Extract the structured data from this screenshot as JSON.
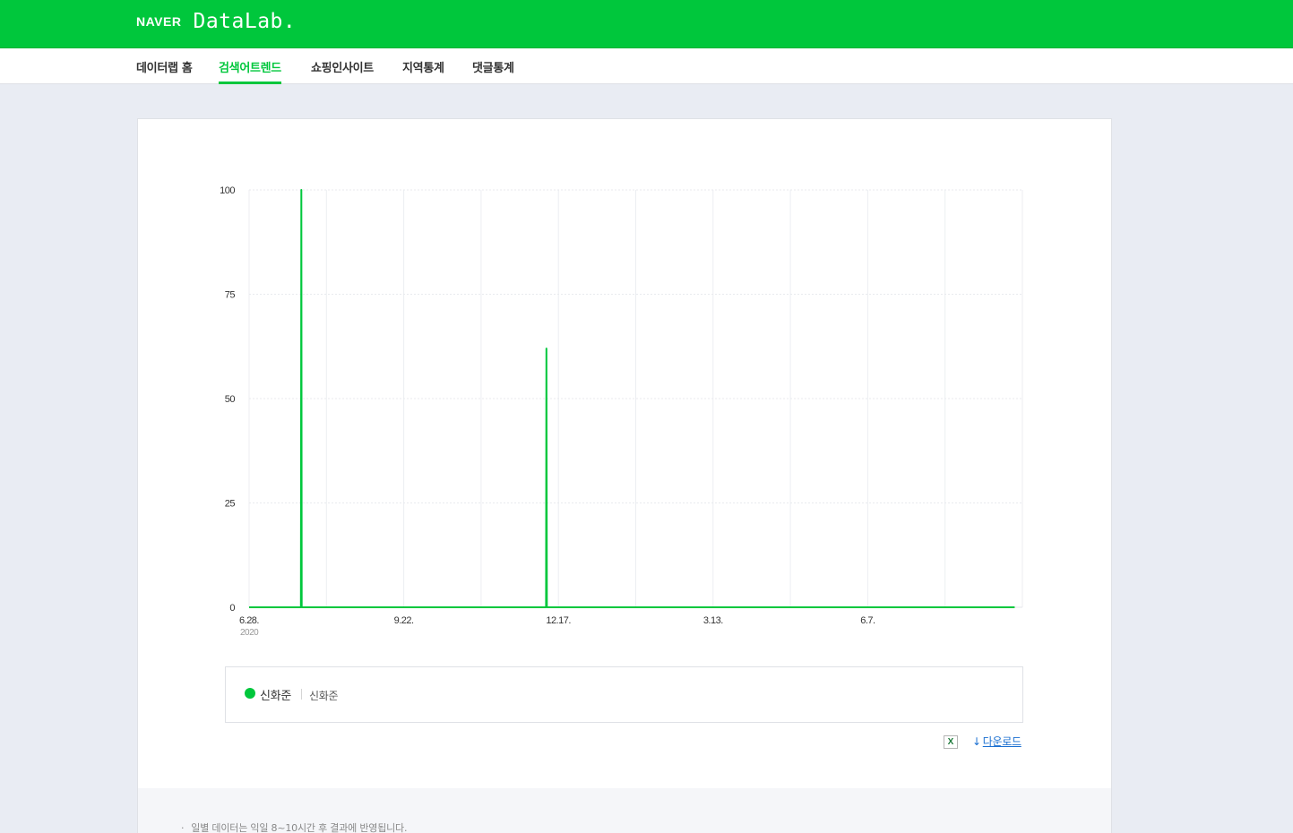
{
  "header": {
    "brand": "NAVER",
    "product": "DataLab."
  },
  "nav": {
    "items": [
      {
        "label": "데이터랩 홈"
      },
      {
        "label": "검색어트렌드"
      },
      {
        "label": "쇼핑인사이트"
      },
      {
        "label": "지역통계"
      },
      {
        "label": "댓글통계"
      }
    ],
    "active_index": 1
  },
  "chart_data": {
    "type": "line",
    "ylim": [
      0,
      100
    ],
    "y_ticks": [
      "100",
      "75",
      "50",
      "25",
      "0"
    ],
    "y_tick_values": [
      100,
      75,
      50,
      25,
      0
    ],
    "x_ticks": [
      "6.28.",
      "9.22.",
      "12.17.",
      "3.13.",
      "6.7."
    ],
    "x_tick_year": "2020",
    "grid": true,
    "series": [
      {
        "name": "신화준",
        "color": "#00c73c",
        "points": [
          {
            "x": 0,
            "y": 0
          },
          {
            "x": 1.34,
            "y": 0
          },
          {
            "x": 1.35,
            "y": 100
          },
          {
            "x": 1.36,
            "y": 0
          },
          {
            "x": 7.68,
            "y": 0
          },
          {
            "x": 7.69,
            "y": 62
          },
          {
            "x": 7.7,
            "y": 0
          },
          {
            "x": 19.8,
            "y": 0
          }
        ]
      }
    ],
    "x_range_weeks": [
      0,
      20
    ],
    "x_tick_positions_weeks": [
      0,
      4,
      8,
      12,
      16
    ]
  },
  "legend": {
    "series_name": "신화준",
    "keywords": "신화준",
    "color": "#00c73c"
  },
  "actions": {
    "excel_icon": "excel-icon",
    "download_label": "다운로드",
    "download_icon": "↓"
  },
  "footer": {
    "note": "일별 데이터는 익일 8~10시간 후 결과에 반영됩니다."
  }
}
